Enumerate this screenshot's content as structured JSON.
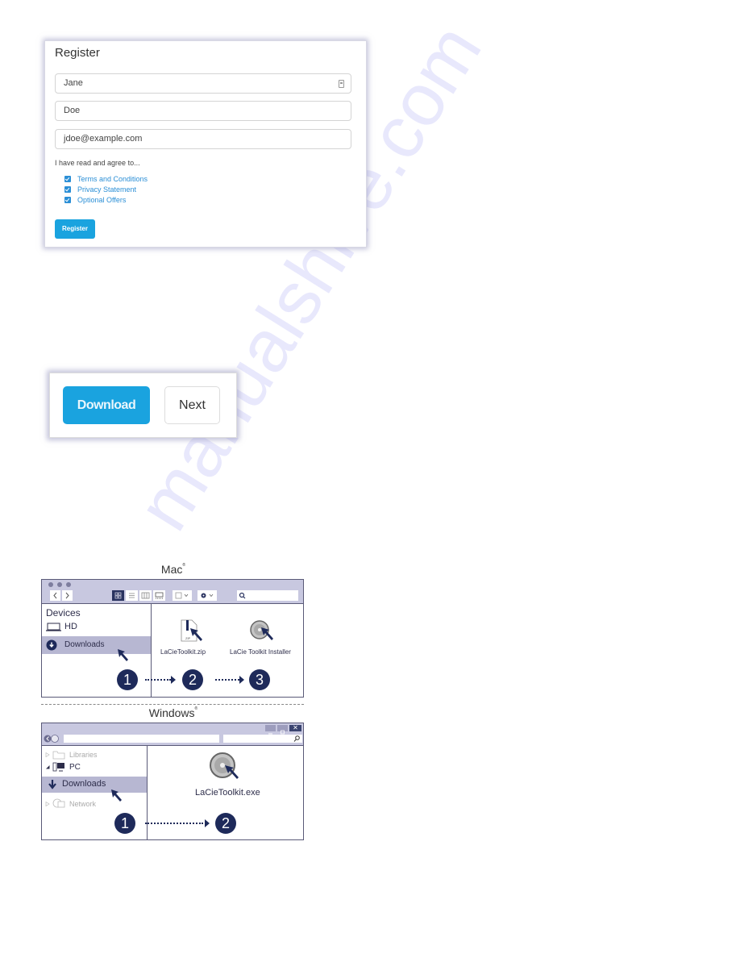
{
  "register_form": {
    "title": "Register",
    "first_name_value": "Jane",
    "last_name_value": "Doe",
    "email_value": "jdoe@example.com",
    "agree_text": "I have read and agree to...",
    "checkboxes": [
      {
        "label": "Terms and Conditions",
        "checked": true
      },
      {
        "label": "Privacy Statement",
        "checked": true
      },
      {
        "label": "Optional Offers",
        "checked": true
      }
    ],
    "submit_label": "Register",
    "accent_color": "#1aa3df"
  },
  "download_panel": {
    "download_label": "Download",
    "next_label": "Next"
  },
  "mac_diagram": {
    "os_label": "Mac",
    "os_label_mark": "®",
    "toolbar": {
      "back_icon": "chevron-left-icon",
      "forward_icon": "chevron-right-icon",
      "view_icons": [
        "icon-view-icon",
        "list-view-icon",
        "column-view-icon",
        "gallery-view-icon"
      ],
      "arrange_icon": "arrange-dropdown-icon",
      "action_icon": "gear-dropdown-icon",
      "search_icon": "search-icon"
    },
    "sidebar": {
      "heading": "Devices",
      "items": [
        {
          "label": "HD",
          "icon": "laptop-icon"
        },
        {
          "label": "Downloads",
          "icon": "download-circle-icon",
          "selected": true
        }
      ]
    },
    "files": [
      {
        "label": "LaCieToolkit.zip",
        "icon": "zip-file-icon",
        "badge": "ZIP"
      },
      {
        "label": "LaCie Toolkit Installer",
        "icon": "disc-installer-icon"
      }
    ],
    "steps": [
      "1",
      "2",
      "3"
    ]
  },
  "windows_diagram": {
    "os_label": "Windows",
    "os_label_mark": "®",
    "title_buttons": [
      "minimize",
      "maximize",
      "close"
    ],
    "close_glyph": "✕",
    "search_glyph": "⌕",
    "sidebar": {
      "items": [
        {
          "label": "Libraries",
          "icon": "libraries-folder-icon",
          "dimmed": true
        },
        {
          "label": "PC",
          "icon": "computer-icon",
          "expanded": true
        },
        {
          "label": "Downloads",
          "icon": "download-arrow-icon",
          "selected": true
        },
        {
          "label": "Network",
          "icon": "network-icon",
          "dimmed": true
        }
      ]
    },
    "files": [
      {
        "label": "LaCieToolkit.exe",
        "icon": "disc-installer-icon"
      }
    ],
    "steps": [
      "1",
      "2"
    ]
  },
  "watermark": "manualshive.com"
}
